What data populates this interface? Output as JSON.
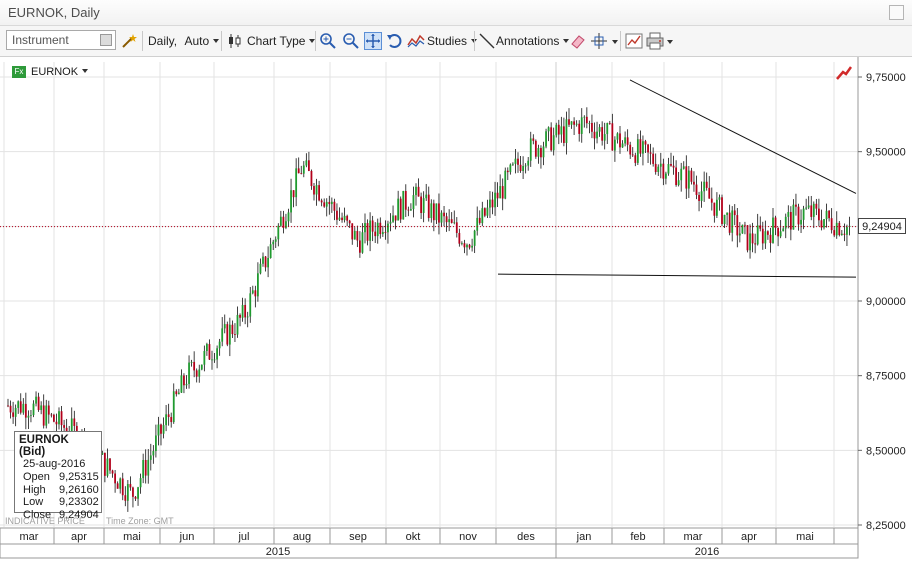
{
  "window": {
    "title": "EURNOK, Daily"
  },
  "toolbar": {
    "instrument_placeholder": "Instrument",
    "period": "Daily,",
    "range": "Auto",
    "chart_type": "Chart Type",
    "studies": "Studies",
    "annotations": "Annotations"
  },
  "instrument": {
    "badge": "Fx",
    "symbol": "EURNOK"
  },
  "last_price": "9,24904",
  "tooltip": {
    "title": "EURNOK (Bid)",
    "date": "25-aug-2016",
    "rows": [
      {
        "key": "Open",
        "value": "9,25315"
      },
      {
        "key": "High",
        "value": "9,26160"
      },
      {
        "key": "Low",
        "value": "9,23302"
      },
      {
        "key": "Close",
        "value": "9,24904"
      }
    ]
  },
  "footer": {
    "left": "INDICATIVE PRICE",
    "tz": "Time Zone: GMT"
  },
  "colors": {
    "up": "#1f9a2f",
    "down": "#b3001b",
    "priceline": "#b3001b"
  },
  "chart_data": {
    "type": "candlestick",
    "y_ticks": [
      "9,75000",
      "9,50000",
      "9,25000",
      "9,00000",
      "8,75000",
      "8,50000",
      "8,25000"
    ],
    "y_tick_values": [
      9.75,
      9.5,
      9.25,
      9.0,
      8.75,
      8.5,
      8.25
    ],
    "ylim": [
      8.25,
      9.75
    ],
    "months": [
      "mar",
      "apr",
      "mai",
      "jun",
      "jul",
      "aug",
      "sep",
      "okt",
      "nov",
      "des",
      "jan",
      "feb",
      "mar",
      "apr",
      "mai"
    ],
    "years": [
      "2015",
      "2016"
    ],
    "monthly_close": [
      8.65,
      8.55,
      8.35,
      8.75,
      8.95,
      9.45,
      9.2,
      9.35,
      9.2,
      9.5,
      9.6,
      9.5,
      9.4,
      9.2,
      9.3
    ],
    "last_close": 9.24904,
    "trendlines": [
      {
        "from": {
          "month": "jan",
          "y": 9.74
        },
        "to": {
          "month": "end",
          "y": 9.36
        }
      },
      {
        "from": {
          "month": "des",
          "y": 9.09
        },
        "to": {
          "month": "end",
          "y": 9.08
        }
      }
    ]
  }
}
